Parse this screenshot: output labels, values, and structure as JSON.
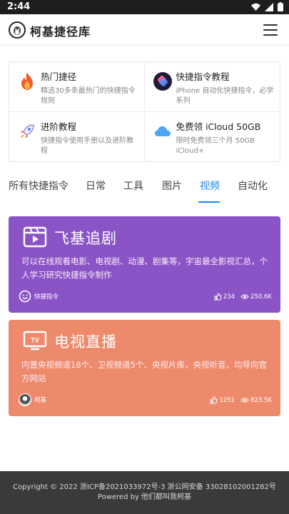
{
  "status": {
    "time": "2:44",
    "icons": [
      "wifi-icon",
      "signal-icon",
      "battery-icon"
    ]
  },
  "appbar": {
    "brand": "柯基捷径库"
  },
  "features": [
    {
      "title": "热门捷径",
      "desc": "精选30多条最热门的快捷指令规则",
      "icon": "fire-icon"
    },
    {
      "title": "快捷指令教程",
      "desc": "iPhone 自动化快捷指令，必学系列",
      "icon": "shortcuts-icon"
    },
    {
      "title": "进阶教程",
      "desc": "快捷指令使用手册以及进阶教程",
      "icon": "rocket-icon"
    },
    {
      "title": "免费领 iCloud 50GB",
      "desc": "限时免费领三个月 50GB iCloud+",
      "icon": "cloud-icon"
    }
  ],
  "tabs": [
    "所有快捷指令",
    "日常",
    "工具",
    "图片",
    "视频",
    "自动化"
  ],
  "active_tab": "视频",
  "cards": [
    {
      "title": "飞基追剧",
      "desc": "可以在线观看电影、电视剧、动漫、剧集等，宇宙最全影视汇总，个人学习研究快捷指令制作",
      "author": "快捷指令",
      "likes": "234",
      "views": "250.6K",
      "icon": "film-icon",
      "color": "#8a54c7"
    },
    {
      "title": "电视直播",
      "desc": "内置央视频道18个、卫视频道5个、央视片库，央视听音，均导向官方网站",
      "author": "柯基",
      "likes": "1251",
      "views": "823.5K",
      "icon": "tv-icon",
      "color": "#ee8a6c"
    }
  ],
  "footer": {
    "line1": "Copyright © 2022 浙ICP备2021033972号-3 浙公网安备 33028102001282号",
    "line2": "Powered by 他们都叫我柯基"
  }
}
